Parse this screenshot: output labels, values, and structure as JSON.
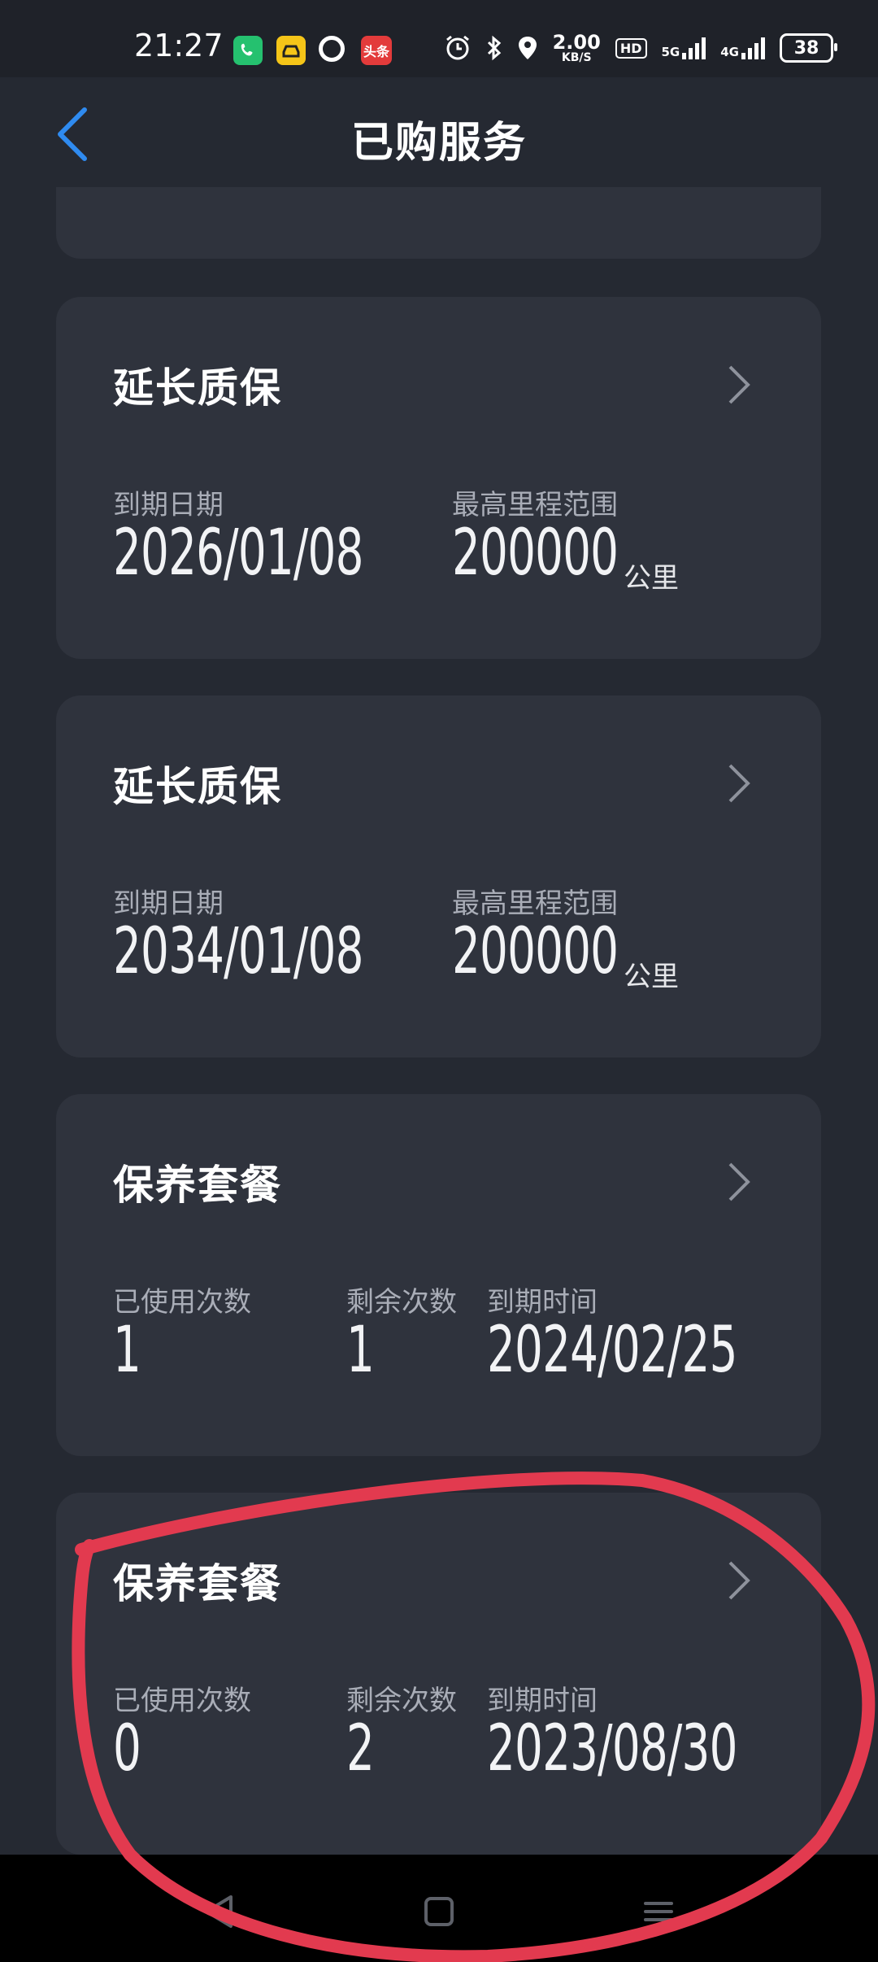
{
  "status_bar": {
    "time": "21:27",
    "news_app_label": "头条",
    "speed_value": "2.00",
    "speed_unit": "KB/S",
    "hd_label": "HD",
    "net1": "5G",
    "net2": "4G",
    "battery": "38"
  },
  "header": {
    "title": "已购服务"
  },
  "cards": [
    {
      "title": "延长质保",
      "label1": "到期日期",
      "value1": "2026/01/08",
      "label2": "最高里程范围",
      "value2": "200000",
      "unit2": "公里"
    },
    {
      "title": "延长质保",
      "label1": "到期日期",
      "value1": "2034/01/08",
      "label2": "最高里程范围",
      "value2": "200000",
      "unit2": "公里"
    },
    {
      "title": "保养套餐",
      "label1": "已使用次数",
      "value1": "1",
      "label2": "剩余次数",
      "value2": "1",
      "label3": "到期时间",
      "value3": "2024/02/25"
    },
    {
      "title": "保养套餐",
      "label1": "已使用次数",
      "value1": "0",
      "label2": "剩余次数",
      "value2": "2",
      "label3": "到期时间",
      "value3": "2023/08/30"
    }
  ],
  "colors": {
    "background": "#252932",
    "card": "#2f333d",
    "accent_back": "#2f8bf0",
    "annotation_red": "#e23a4f"
  }
}
